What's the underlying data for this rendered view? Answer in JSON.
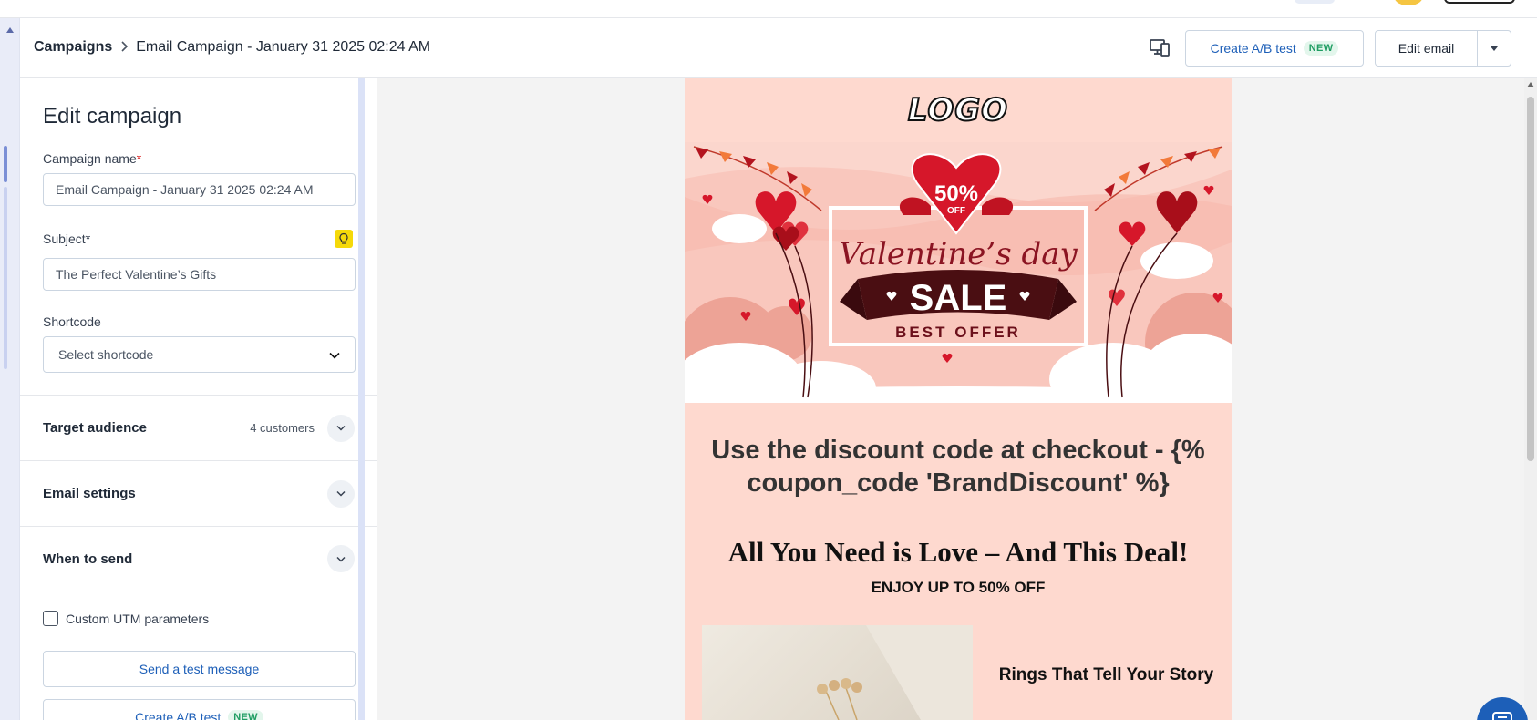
{
  "header": {
    "breadcrumb_root": "Campaigns",
    "breadcrumb_current": "Email Campaign - January 31 2025 02:24 AM",
    "create_ab_label": "Create A/B test",
    "new_badge": "NEW",
    "edit_email_label": "Edit email",
    "device_icon": "desktop-mobile-icon"
  },
  "panel": {
    "title": "Edit campaign",
    "campaign_name_label": "Campaign name",
    "required_mark": "*",
    "campaign_name_value": "Email Campaign - January 31 2025 02:24 AM",
    "subject_label": "Subject*",
    "subject_value": "The Perfect Valentine’s Gifts",
    "shortcode_label": "Shortcode",
    "shortcode_placeholder": "Select shortcode",
    "sections": [
      {
        "title": "Target audience",
        "meta": "4 customers"
      },
      {
        "title": "Email settings",
        "meta": ""
      },
      {
        "title": "When to send",
        "meta": ""
      }
    ],
    "utm_label": "Custom UTM parameters",
    "test_message_label": "Send a test message",
    "ab_test_label": "Create A/B test",
    "ab_new_badge": "NEW"
  },
  "email": {
    "logo": "LOGO",
    "banner": {
      "discount": "50%",
      "off": "OFF",
      "script": "Valentine’s day",
      "sale": "SALE",
      "best_offer": "BEST OFFER"
    },
    "coupon_text": "Use the discount code at checkout - {% coupon_code 'BrandDiscount' %}",
    "heading": "All You Need is Love – And This Deal!",
    "subheading": "ENJOY UP TO 50% OFF",
    "product_title": "Rings That Tell Your Story"
  },
  "colors": {
    "accent": "#1d5fb8",
    "email_background": "#fed9cf",
    "banner_red": "#d6172a",
    "ribbon": "#4a0e12"
  }
}
